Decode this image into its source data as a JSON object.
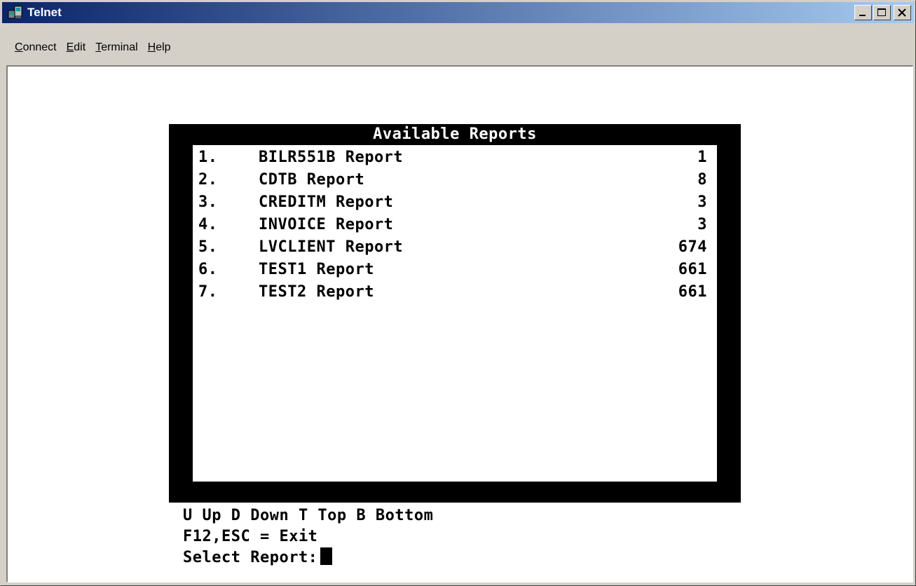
{
  "window": {
    "title": "Telnet",
    "icon": "telnet-app-icon",
    "buttons": [
      "minimize-icon",
      "maximize-icon",
      "close-icon"
    ]
  },
  "menu": {
    "items": [
      {
        "label": "Connect",
        "underline": "C"
      },
      {
        "label": "Edit",
        "underline": "E"
      },
      {
        "label": "Terminal",
        "underline": "T"
      },
      {
        "label": "Help",
        "underline": "H"
      }
    ]
  },
  "reports": {
    "title": "Available Reports",
    "rows": [
      {
        "num": "1.",
        "name": "BILR551B Report",
        "count": "1"
      },
      {
        "num": "2.",
        "name": "CDTB Report",
        "count": "8"
      },
      {
        "num": "3.",
        "name": "CREDITM Report",
        "count": "3"
      },
      {
        "num": "4.",
        "name": "INVOICE Report",
        "count": "3"
      },
      {
        "num": "5.",
        "name": "LVCLIENT Report",
        "count": "674"
      },
      {
        "num": "6.",
        "name": "TEST1 Report",
        "count": "661"
      },
      {
        "num": "7.",
        "name": "TEST2 Report",
        "count": "661"
      }
    ]
  },
  "footer": {
    "nav_help": "U Up D Down T Top B Bottom",
    "exit_help": "F12,ESC = Exit",
    "prompt": "Select Report:"
  },
  "colors": {
    "title_bar_start": "#0a246a",
    "title_bar_end": "#a6caf0",
    "window_face": "#d4d0c8",
    "terminal_bg": "#ffffff",
    "terminal_text": "#000000"
  }
}
